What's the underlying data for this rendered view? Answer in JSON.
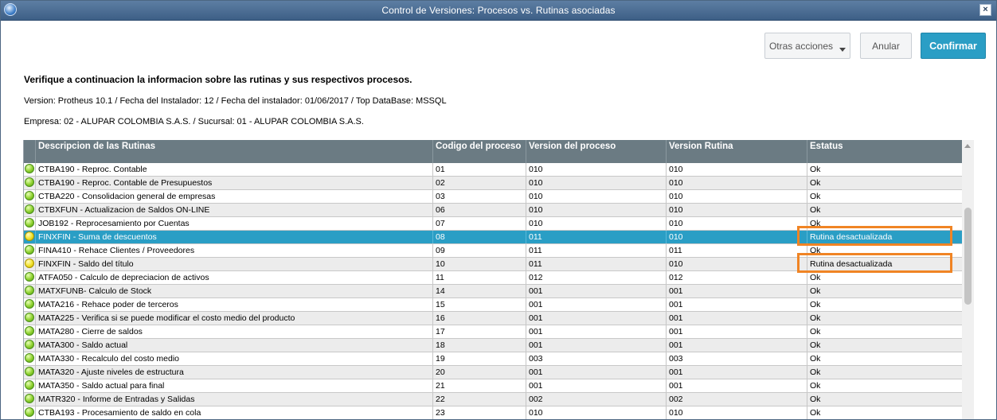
{
  "window": {
    "title": "Control de Versiones: Procesos vs. Rutinas asociadas",
    "close_symbol": "×"
  },
  "toolbar": {
    "otras_label": "Otras acciones",
    "anular_label": "Anular",
    "confirmar_label": "Confirmar"
  },
  "info": {
    "title": "Verifique a continuacion la informacion sobre las rutinas y sus respectivos procesos.",
    "version": "Version: Protheus 10.1 / Fecha del Instalador: 12 / Fecha del instalador: 01/06/2017 / Top DataBase: MSSQL",
    "empresa": "Empresa: 02 - ALUPAR COLOMBIA S.A.S. / Sucursal: 01 - ALUPAR COLOMBIA S.A.S."
  },
  "grid": {
    "headers": [
      "Descripcion de las Rutinas",
      "Codigo del proceso",
      "Version del proceso",
      "Version Rutina",
      "Estatus"
    ],
    "rows": [
      {
        "status_color": "green",
        "desc": "CTBA190 - Reproc. Contable",
        "codigo": "01",
        "vproceso": "010",
        "vrutina": "010",
        "estatus": "Ok"
      },
      {
        "status_color": "green",
        "desc": "CTBA190 - Reproc. Contable de Presupuestos",
        "codigo": "02",
        "vproceso": "010",
        "vrutina": "010",
        "estatus": "Ok"
      },
      {
        "status_color": "green",
        "desc": "CTBA220 - Consolidacion general de empresas",
        "codigo": "03",
        "vproceso": "010",
        "vrutina": "010",
        "estatus": "Ok"
      },
      {
        "status_color": "green",
        "desc": "CTBXFUN - Actualizacion de Saldos ON-LINE",
        "codigo": "06",
        "vproceso": "010",
        "vrutina": "010",
        "estatus": "Ok"
      },
      {
        "status_color": "green",
        "desc": "JOB192 - Reprocesamiento por Cuentas",
        "codigo": "07",
        "vproceso": "010",
        "vrutina": "010",
        "estatus": "Ok"
      },
      {
        "status_color": "yellow",
        "desc": "FINXFIN - Suma de descuentos",
        "codigo": "08",
        "vproceso": "011",
        "vrutina": "010",
        "estatus": "Rutina desactualizada"
      },
      {
        "status_color": "green",
        "desc": "FINA410 - Rehace Clientes / Proveedores",
        "codigo": "09",
        "vproceso": "011",
        "vrutina": "011",
        "estatus": "Ok"
      },
      {
        "status_color": "yellow",
        "desc": "FINXFIN - Saldo del título",
        "codigo": "10",
        "vproceso": "011",
        "vrutina": "010",
        "estatus": "Rutina desactualizada"
      },
      {
        "status_color": "green",
        "desc": "ATFA050 - Calculo de depreciacion de activos",
        "codigo": "11",
        "vproceso": "012",
        "vrutina": "012",
        "estatus": "Ok"
      },
      {
        "status_color": "green",
        "desc": "MATXFUNB- Calculo de Stock",
        "codigo": "14",
        "vproceso": "001",
        "vrutina": "001",
        "estatus": "Ok"
      },
      {
        "status_color": "green",
        "desc": "MATA216 - Rehace poder de terceros",
        "codigo": "15",
        "vproceso": "001",
        "vrutina": "001",
        "estatus": "Ok"
      },
      {
        "status_color": "green",
        "desc": "MATA225 - Verifica si se puede modificar el costo medio del producto",
        "codigo": "16",
        "vproceso": "001",
        "vrutina": "001",
        "estatus": "Ok"
      },
      {
        "status_color": "green",
        "desc": "MATA280 - Cierre de saldos",
        "codigo": "17",
        "vproceso": "001",
        "vrutina": "001",
        "estatus": "Ok"
      },
      {
        "status_color": "green",
        "desc": "MATA300 - Saldo actual",
        "codigo": "18",
        "vproceso": "001",
        "vrutina": "001",
        "estatus": "Ok"
      },
      {
        "status_color": "green",
        "desc": "MATA330 - Recalculo del costo medio",
        "codigo": "19",
        "vproceso": "003",
        "vrutina": "003",
        "estatus": "Ok"
      },
      {
        "status_color": "green",
        "desc": "MATA320 - Ajuste niveles de estructura",
        "codigo": "20",
        "vproceso": "001",
        "vrutina": "001",
        "estatus": "Ok"
      },
      {
        "status_color": "green",
        "desc": "MATA350 - Saldo actual para final",
        "codigo": "21",
        "vproceso": "001",
        "vrutina": "001",
        "estatus": "Ok"
      },
      {
        "status_color": "green",
        "desc": "MATR320 - Informe de Entradas y Salidas",
        "codigo": "22",
        "vproceso": "002",
        "vrutina": "002",
        "estatus": "Ok"
      },
      {
        "status_color": "green",
        "desc": "CTBA193 - Procesamiento de saldo en cola",
        "codigo": "23",
        "vproceso": "010",
        "vrutina": "010",
        "estatus": "Ok"
      }
    ],
    "selected_row_index": 5,
    "highlighted_row_indexes": [
      5,
      7
    ]
  },
  "colors": {
    "accent": "#2a9ec5",
    "header_bg": "#6b7b83",
    "highlight_border": "#f08424"
  }
}
